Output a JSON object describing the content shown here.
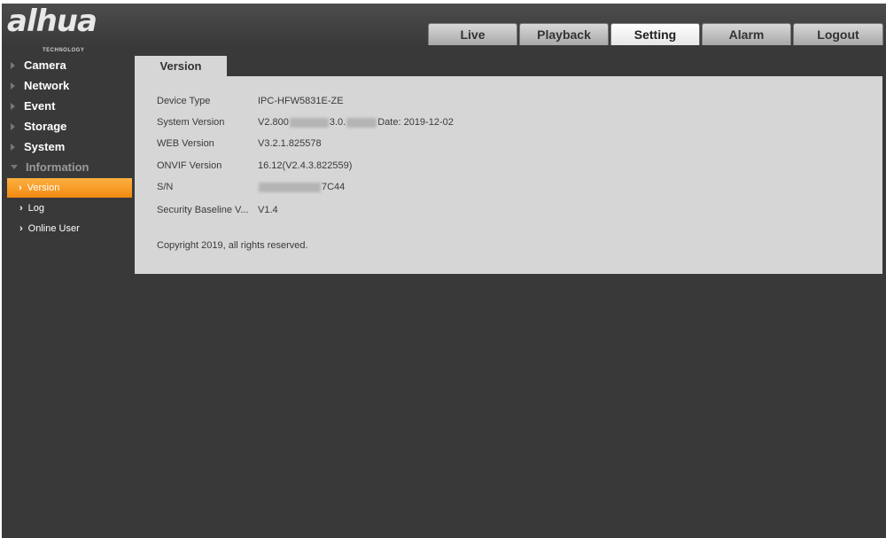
{
  "brand": {
    "logo_text": "alhua",
    "logo_sub": "TECHNOLOGY"
  },
  "tabs": [
    {
      "label": "Live",
      "active": false
    },
    {
      "label": "Playback",
      "active": false
    },
    {
      "label": "Setting",
      "active": true
    },
    {
      "label": "Alarm",
      "active": false
    },
    {
      "label": "Logout",
      "active": false
    }
  ],
  "sidebar": {
    "items": [
      {
        "label": "Camera"
      },
      {
        "label": "Network"
      },
      {
        "label": "Event"
      },
      {
        "label": "Storage"
      },
      {
        "label": "System"
      },
      {
        "label": "Information"
      }
    ],
    "sub_items": [
      {
        "label": "Version",
        "active": true
      },
      {
        "label": "Log",
        "active": false
      },
      {
        "label": "Online User",
        "active": false
      }
    ]
  },
  "panel": {
    "tab_label": "Version",
    "rows": [
      {
        "label": "Device Type",
        "value": "IPC-HFW5831E-ZE"
      },
      {
        "label": "System Version",
        "value_a": "V2.800",
        "value_b": "3.0.",
        "value_c": "Date: 2019-12-02"
      },
      {
        "label": "WEB Version",
        "value": "V3.2.1.825578"
      },
      {
        "label": "ONVIF Version",
        "value": "16.12(V2.4.3.822559)"
      },
      {
        "label": "S/N",
        "value_a": "",
        "value_b": "7C44"
      },
      {
        "label": "Security Baseline V...",
        "value": "V1.4"
      }
    ],
    "copyright": "Copyright 2019, all rights reserved."
  },
  "colors": {
    "accent": "#f39a1e",
    "background": "#393939",
    "panel": "#d6d6d6"
  }
}
